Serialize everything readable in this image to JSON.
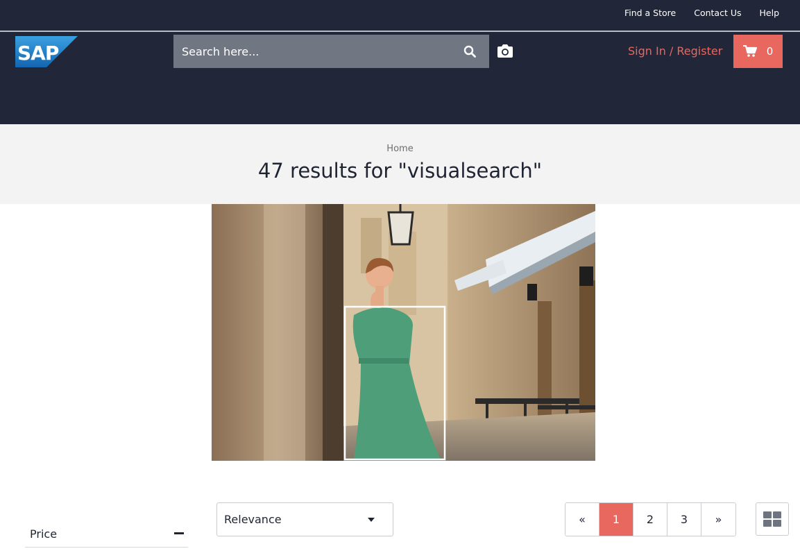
{
  "colors": {
    "header_bg": "#212738",
    "accent": "#e8675f",
    "search_bg": "#707682",
    "title_band_bg": "#f3f3f3",
    "highlight_dress": "#4e9e7a"
  },
  "utility_nav": {
    "links": [
      "Find a Store",
      "Contact Us",
      "Help"
    ]
  },
  "logo": {
    "text": "SAP"
  },
  "search": {
    "placeholder": "Search here...",
    "search_icon": "search-icon",
    "camera_icon": "camera-icon"
  },
  "account": {
    "signin_label": "Sign In / Register"
  },
  "cart": {
    "icon": "cart-icon",
    "count": "0"
  },
  "breadcrumb": {
    "home": "Home"
  },
  "results": {
    "title": "47 results for \"visualsearch\""
  },
  "visual_search": {
    "image_description_icon": "street-photo-woman-green-dress",
    "selection_box": "detected-dress-selection"
  },
  "facets": [
    {
      "title": "Price",
      "expanded": true
    }
  ],
  "sort": {
    "selected": "Relevance"
  },
  "pagination": {
    "prev": "«",
    "pages": [
      "1",
      "2",
      "3"
    ],
    "current": "1",
    "next": "»"
  },
  "view_toggle": {
    "icon": "grid-view-icon"
  }
}
